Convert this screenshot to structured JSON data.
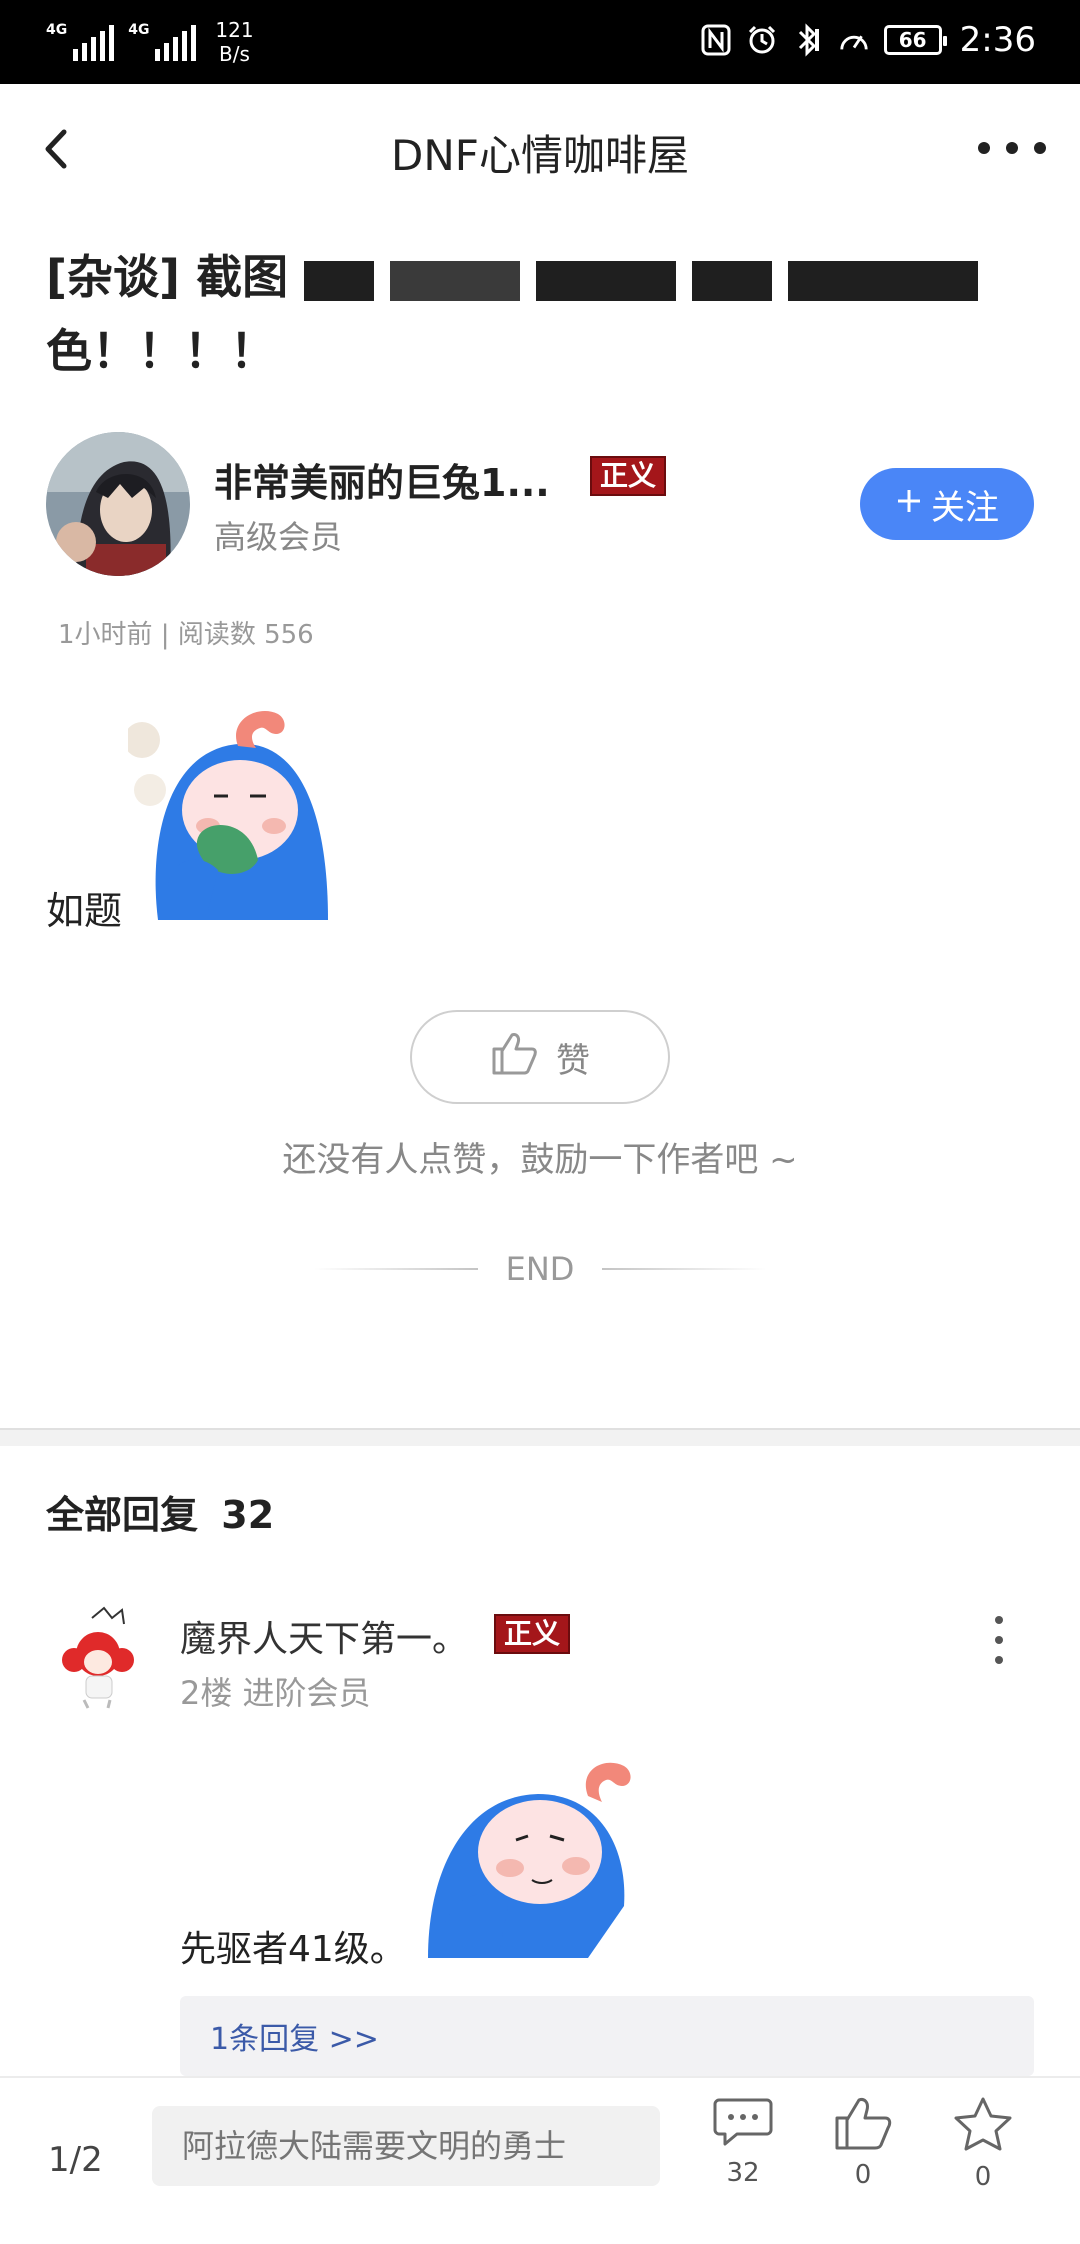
{
  "status_bar": {
    "sim1": "4G",
    "sim2": "4G",
    "net_speed_value": "121",
    "net_speed_unit": "B/s",
    "battery": "66",
    "time": "2:36",
    "icons": [
      "nfc-icon",
      "alarm-icon",
      "bluetooth-icon",
      "speed-icon",
      "battery-icon"
    ]
  },
  "nav": {
    "title": "DNF心情咖啡屋",
    "back_icon": "back-arrow-icon",
    "more_icon": "more-dots-icon"
  },
  "post": {
    "title_prefix": "[杂谈]",
    "title_visible_part": "截图",
    "title_line2": "色！！！！",
    "meta": "1小时前 | 阅读数 556",
    "body_text": "如题"
  },
  "author": {
    "name": "非常美丽的巨兔1...",
    "badge": "正义",
    "level": "高级会员",
    "follow_label": "关注",
    "follow_icon": "plus-icon"
  },
  "like": {
    "label": "赞",
    "hint": "还没有人点赞，鼓励一下作者吧 ~",
    "end_label": "END"
  },
  "replies": {
    "header_label": "全部回复",
    "count": "32",
    "items": [
      {
        "name": "魔界人天下第一。",
        "badge": "正义",
        "meta": "2楼 进阶会员",
        "text": "先驱者41级。",
        "sub_replies_label": "1条回复 >>"
      }
    ]
  },
  "bottom_bar": {
    "page_indicator": "1/2",
    "input_placeholder": "阿拉德大陆需要文明的勇士",
    "comment_count": "32",
    "like_count": "0",
    "star_count": "0"
  },
  "colors": {
    "accent_blue": "#4a86f7",
    "badge_red": "#a4161a",
    "link_blue": "#3b5aa8",
    "sticker_blue": "#2e7be6",
    "sticker_pink": "#f4b8b0"
  }
}
